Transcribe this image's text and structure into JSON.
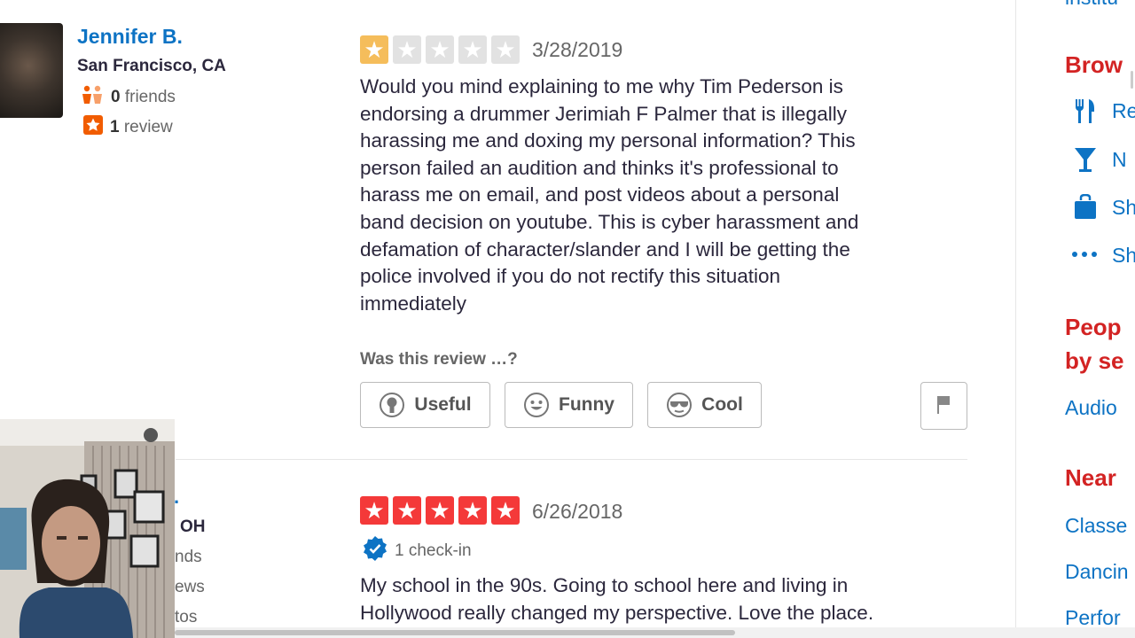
{
  "review1": {
    "user": {
      "name": "Jennifer B.",
      "location": "San Francisco, CA",
      "friends_count": "0",
      "friends_label": "friends",
      "reviews_count": "1",
      "reviews_label": "review"
    },
    "rating": 1,
    "date": "3/28/2019",
    "lines": [
      "Would you mind explaining to me why Tim Pederson is",
      "endorsing a drummer Jerimiah F Palmer that is illegally",
      "harassing me and doxing my personal information? This",
      "person failed an audition and thinks it's professional to",
      "harass me on email, and post videos about a personal",
      "band decision on youtube. This is cyber harassment and",
      "defamation of character/slander and I will be getting the",
      "police involved if you do not rectify this situation",
      "immediately"
    ],
    "vote_prompt": "Was this review …?",
    "buttons": {
      "useful": "Useful",
      "funny": "Funny",
      "cool": "Cool"
    }
  },
  "review2": {
    "user_partial": {
      "dot": ".",
      "location": "OH",
      "friends": "nds",
      "reviews": "ews",
      "photos": "tos"
    },
    "rating": 5,
    "date": "6/26/2018",
    "checkin": "1 check-in",
    "lines": [
      "My school in the 90s. Going to school here and living in",
      "Hollywood really changed my perspective. Love the place."
    ]
  },
  "sidebar": {
    "top_partial": "institu",
    "browse_heading": "Brow",
    "browse_items": [
      {
        "icon": "fork-knife-icon",
        "label": "Re"
      },
      {
        "icon": "cocktail-icon",
        "label": "N"
      },
      {
        "icon": "shopping-bag-icon",
        "label": "Sh"
      },
      {
        "icon": "more-dots-icon",
        "label": "Sh"
      }
    ],
    "people_heading_1": "Peop",
    "people_heading_2": "by se",
    "people_link": "Audio",
    "near_heading": "Near",
    "near_links": [
      "Classe",
      "Dancin",
      "Perfor"
    ]
  },
  "colors": {
    "link_blue": "#0d73c4",
    "red": "#d32323",
    "star_red": "#f43939",
    "star_one": "#f5bd5b",
    "star_empty": "#e2e2e2"
  }
}
